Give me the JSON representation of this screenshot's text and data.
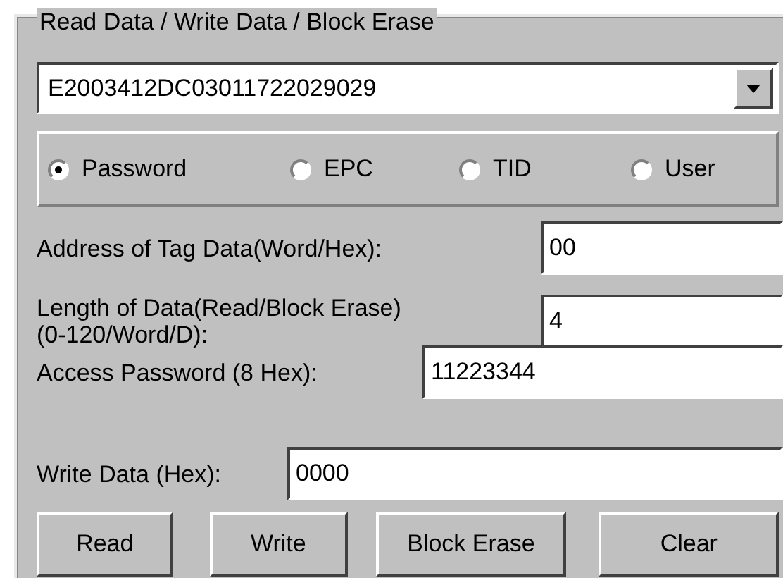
{
  "group": {
    "title": "Read Data / Write Data / Block Erase"
  },
  "tag_select": {
    "value": "E2003412DC03011722029029"
  },
  "memory_banks": [
    {
      "label": "Password",
      "selected": true
    },
    {
      "label": "EPC",
      "selected": false
    },
    {
      "label": "TID",
      "selected": false
    },
    {
      "label": "User",
      "selected": false
    }
  ],
  "fields": [
    {
      "label": "Address of Tag Data(Word/Hex):",
      "value": "00"
    },
    {
      "label": "Length of Data(Read/Block Erase)\n(0-120/Word/D):",
      "value": "4"
    },
    {
      "label": "Access Password (8 Hex):",
      "value": "11223344"
    },
    {
      "label": "Write Data (Hex):",
      "value": "0000"
    }
  ],
  "buttons": [
    "Read",
    "Write",
    "Block Erase",
    "Clear"
  ]
}
